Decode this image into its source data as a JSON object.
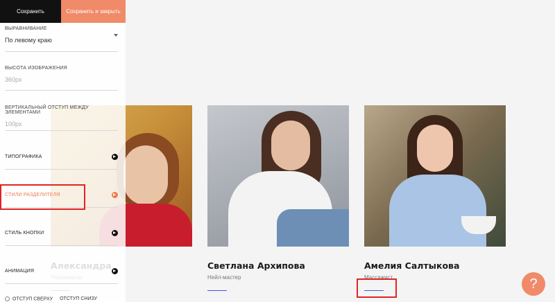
{
  "toolbar": {
    "save_label": "Сохранить",
    "save_close_label": "Сохранить и закрыть"
  },
  "settings": {
    "alignment": {
      "label": "ВЫРАВНИВАНИЕ",
      "value": "По левому краю"
    },
    "image_height": {
      "label": "ВЫСОТА ИЗОБРАЖЕНИЯ",
      "placeholder": "360px"
    },
    "vertical_gap": {
      "label": "ВЕРТИКАЛЬНЫЙ ОТСТУП МЕЖДУ ЭЛЕМЕНТАМИ",
      "placeholder": "100px"
    },
    "groups": [
      {
        "label": "ТИПОГРАФИКА",
        "active": false
      },
      {
        "label": "СТИЛИ РАЗДЕЛИТЕЛЯ",
        "active": true
      },
      {
        "label": "СТИЛЬ КНОПКИ",
        "active": false
      },
      {
        "label": "АНИМАЦИЯ",
        "active": false
      }
    ],
    "padding_top_label": "ОТСТУП СВЕРХУ",
    "padding_bottom_label": "ОТСТУП СНИЗУ"
  },
  "team": [
    {
      "name": "Александра",
      "role": "Парикмахер"
    },
    {
      "name": "Светлана Архипова",
      "role": "Нейл-мастер"
    },
    {
      "name": "Амелия Салтыкова",
      "role": "Массажист"
    }
  ],
  "colors": {
    "accent": "#f08a68",
    "divider": "#3b5bdb",
    "highlight": "#e02424"
  },
  "help": {
    "label": "?"
  }
}
